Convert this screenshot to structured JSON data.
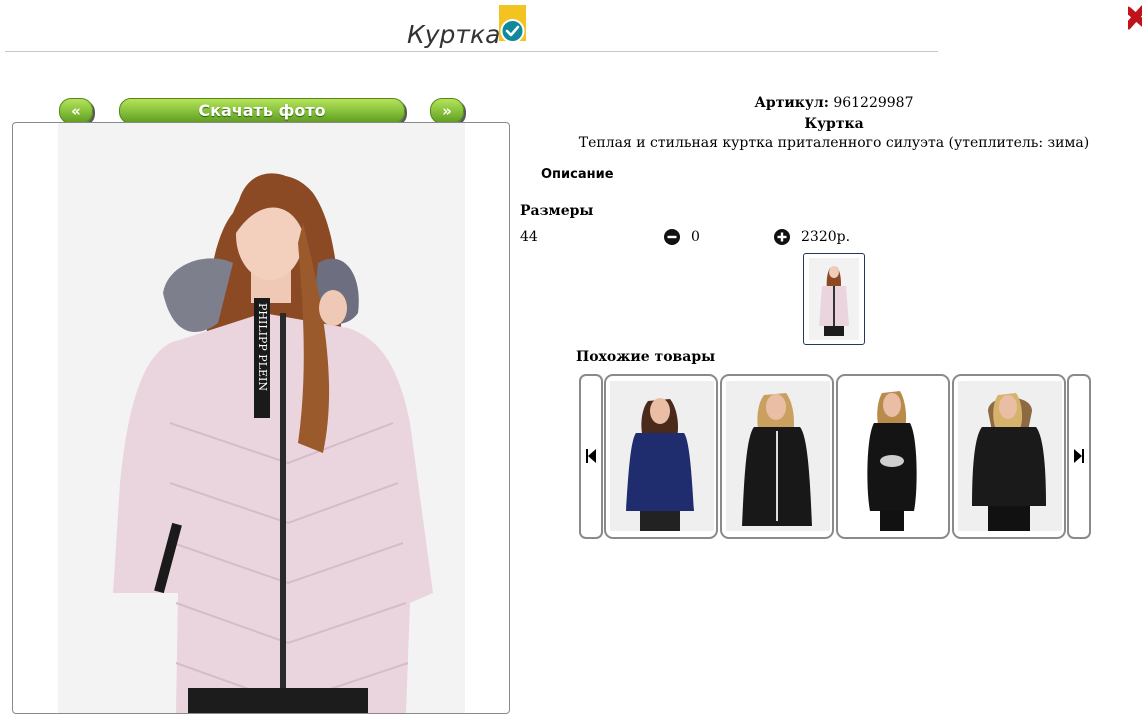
{
  "header": {
    "title": "Куртка",
    "badge_icon": "verified-check-icon",
    "close_icon": "close-x-icon"
  },
  "gallery": {
    "prev_label": "«",
    "download_label": "Скачать фото",
    "next_label": "»",
    "photo_text": [
      "PHILIPP PLEIN",
      "PHILIPP",
      "PHIL"
    ]
  },
  "product": {
    "sku_label": "Артикул:",
    "sku_value": "961229987",
    "name": "Куртка",
    "description": "Теплая и стильная куртка приталенного силуэта (утеплитель: зима)",
    "description_heading": "Описание",
    "sizes_heading": "Размеры",
    "size": "44",
    "quantity": "0",
    "price": "2320р."
  },
  "similar": {
    "heading": "Похожие товары",
    "items": [
      {
        "jacket_color": "#1f2d6e",
        "hair_color": "#4a2a1a"
      },
      {
        "jacket_color": "#181818",
        "hair_color": "#c9a060"
      },
      {
        "jacket_color": "#141414",
        "hair_color": "#b98b4a"
      },
      {
        "jacket_color": "#1a1a1a",
        "hair_color": "#d6b36a"
      }
    ]
  },
  "colors": {
    "accent_green": "#8cc63f",
    "jacket_pink": "#e9d3dc"
  }
}
